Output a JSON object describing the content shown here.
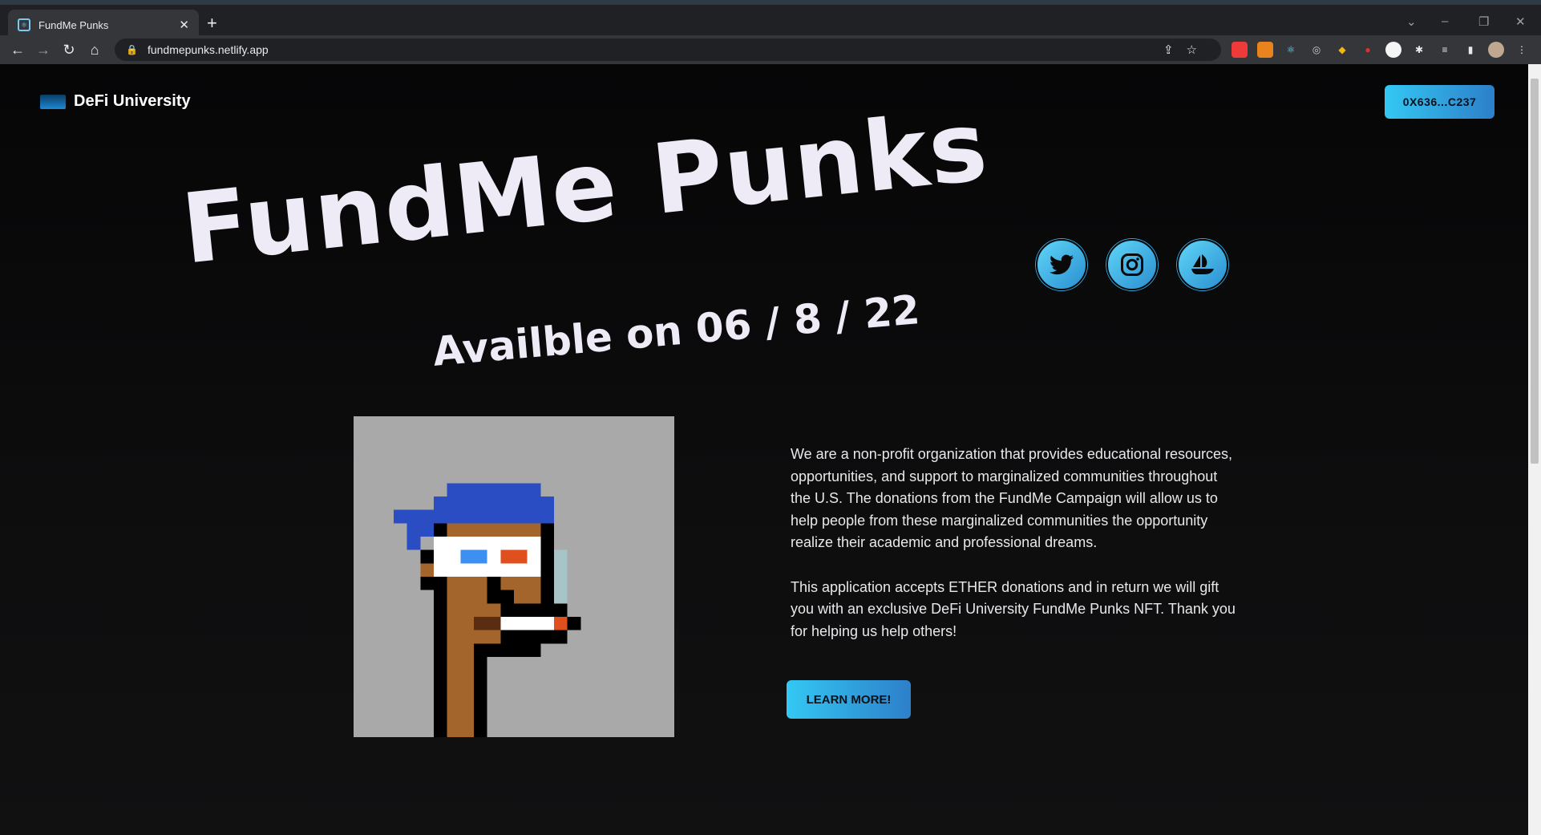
{
  "browser": {
    "tab_title": "FundMe Punks",
    "url": "fundmepunks.netlify.app"
  },
  "header": {
    "brand_name": "DeFi University",
    "wallet_label": "0X636...C237"
  },
  "hero": {
    "title": "FundMe Punks",
    "subtitle": "Availble on 06 / 8 / 22"
  },
  "socials": [
    {
      "icon": "twitter-icon"
    },
    {
      "icon": "instagram-icon"
    },
    {
      "icon": "opensea-icon"
    }
  ],
  "about": {
    "paragraph_1": "We are a non-profit organization that provides educational resources, opportunities, and support to marginalized communities throughout the U.S. The donations from the FundMe Campaign will allow us to help people from these marginalized communities the opportunity realize their academic and professional dreams.",
    "paragraph_2": "This application accepts ETHER donations and in return we will gift you with an exclusive DeFi University FundMe Punks NFT. Thank you for helping us help others!",
    "cta_label": "LEARN MORE!"
  },
  "colors": {
    "accent_start": "#34c8f4",
    "accent_end": "#2d7fc9",
    "background": "#0b0b0c",
    "title_text": "#eeeaf6"
  }
}
